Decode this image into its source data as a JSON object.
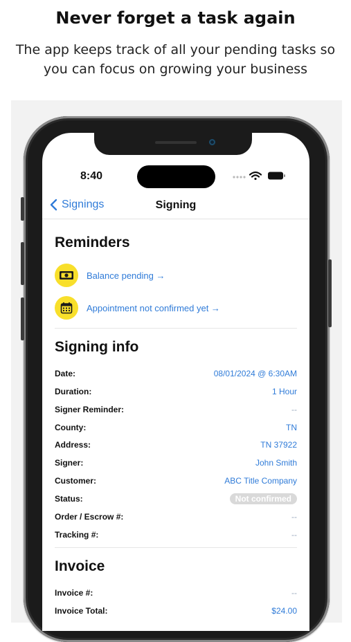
{
  "promo": {
    "headline": "Never forget a task again",
    "subtitle_line1": "The app keeps track of all your pending tasks so",
    "subtitle_line2": "you can focus on growing your business"
  },
  "statusbar": {
    "time": "8:40",
    "icons": [
      "signal-dots-icon",
      "wifi-icon",
      "battery-icon"
    ]
  },
  "navbar": {
    "back_label": "Signings",
    "title": "Signing"
  },
  "reminders": {
    "title": "Reminders",
    "items": [
      {
        "icon": "money-icon",
        "label": "Balance pending →"
      },
      {
        "icon": "calendar-icon",
        "label": "Appointment not confirmed yet →"
      }
    ]
  },
  "signing_info": {
    "title": "Signing info",
    "rows": [
      {
        "key": "Date:",
        "value": "08/01/2024 @ 6:30AM"
      },
      {
        "key": "Duration:",
        "value": "1 Hour"
      },
      {
        "key": "Signer Reminder:",
        "value": "--"
      },
      {
        "key": "County:",
        "value": "TN"
      },
      {
        "key": "Address:",
        "value": "TN 37922"
      },
      {
        "key": "Signer:",
        "value": "John Smith"
      },
      {
        "key": "Customer:",
        "value": "ABC Title Company"
      },
      {
        "key": "Status:",
        "value": "Not confirmed"
      },
      {
        "key": "Order / Escrow #:",
        "value": "--"
      },
      {
        "key": "Tracking #:",
        "value": "--"
      }
    ]
  },
  "invoice": {
    "title": "Invoice",
    "rows": [
      {
        "key": "Invoice #:",
        "value": "--"
      },
      {
        "key": "Invoice Total:",
        "value": "$24.00"
      }
    ]
  },
  "colors": {
    "accent": "#2f7bd8",
    "reminder_icon_bg": "#f8df2b",
    "badge_bg": "#d9d9d9"
  }
}
